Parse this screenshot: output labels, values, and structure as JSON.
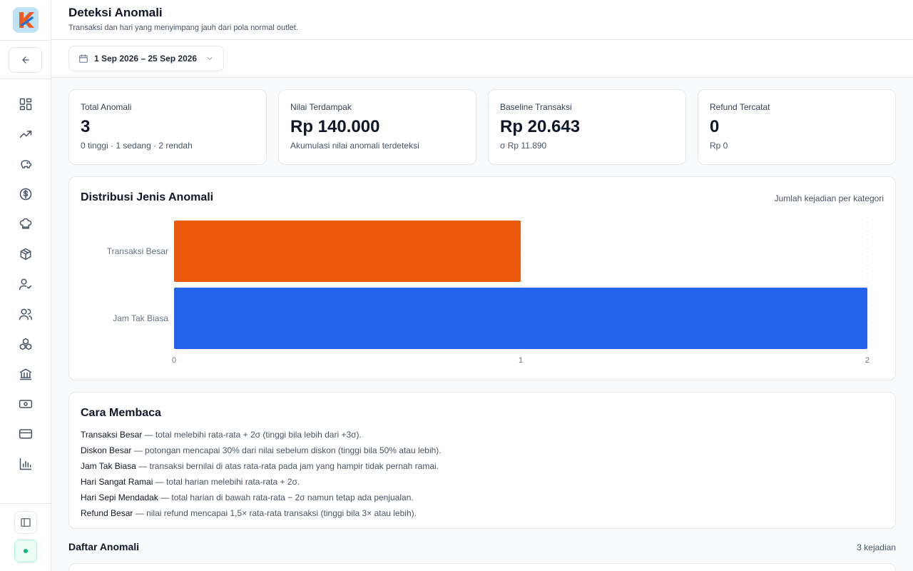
{
  "header": {
    "title": "Deteksi Anomali",
    "subtitle": "Transaksi dan hari yang menyimpang jauh dari pola normal outlet."
  },
  "filters": {
    "date_range": "1 Sep 2026 – 25 Sep 2026"
  },
  "sidebar": {
    "items": [
      {
        "icon": "dashboard-icon"
      },
      {
        "icon": "trending-up-icon"
      },
      {
        "icon": "piggy-bank-icon"
      },
      {
        "icon": "dollar-circle-icon"
      },
      {
        "icon": "chef-hat-icon"
      },
      {
        "icon": "package-icon"
      },
      {
        "icon": "user-check-icon"
      },
      {
        "icon": "users-icon"
      },
      {
        "icon": "boxes-icon"
      },
      {
        "icon": "bank-icon"
      },
      {
        "icon": "banknote-icon"
      },
      {
        "icon": "credit-card-icon"
      },
      {
        "icon": "bar-chart-icon"
      }
    ]
  },
  "stats": [
    {
      "label": "Total Anomali",
      "value": "3",
      "sub": "0 tinggi · 1 sedang · 2 rendah"
    },
    {
      "label": "Nilai Terdampak",
      "value": "Rp 140.000",
      "sub": "Akumulasi nilai anomali terdeteksi"
    },
    {
      "label": "Baseline Transaksi",
      "value": "Rp 20.643",
      "sub": "σ Rp 11.890"
    },
    {
      "label": "Refund Tercatat",
      "value": "0",
      "sub": "Rp 0"
    }
  ],
  "chart_section": {
    "title": "Distribusi Jenis Anomali",
    "hint": "Jumlah kejadian per kategori"
  },
  "chart_data": {
    "type": "bar",
    "orientation": "horizontal",
    "categories": [
      "Transaksi Besar",
      "Jam Tak Biasa"
    ],
    "values": [
      1,
      2
    ],
    "colors": [
      "#ea580c",
      "#2563eb"
    ],
    "xlim": [
      0,
      2
    ],
    "xticks": [
      "0",
      "1",
      "2"
    ],
    "grid": true
  },
  "guide": {
    "title": "Cara Membaca",
    "rows": [
      {
        "term": "Transaksi Besar",
        "desc": " — total melebihi rata-rata + 2σ (tinggi bila lebih dari +3σ)."
      },
      {
        "term": "Diskon Besar",
        "desc": " — potongan mencapai 30% dari nilai sebelum diskon (tinggi bila 50% atau lebih)."
      },
      {
        "term": "Jam Tak Biasa",
        "desc": " — transaksi bernilai di atas rata-rata pada jam yang hampir tidak pernah ramai."
      },
      {
        "term": "Hari Sangat Ramai",
        "desc": " — total harian melebihi rata-rata + 2σ."
      },
      {
        "term": "Hari Sepi Mendadak",
        "desc": " — total harian di bawah rata-rata − 2σ namun tetap ada penjualan."
      },
      {
        "term": "Refund Besar",
        "desc": " — nilai refund mencapai 1,5× rata-rata transaksi (tinggi bila 3× atau lebih)."
      }
    ]
  },
  "list_section": {
    "title": "Daftar Anomali",
    "count": "3 kejadian"
  }
}
